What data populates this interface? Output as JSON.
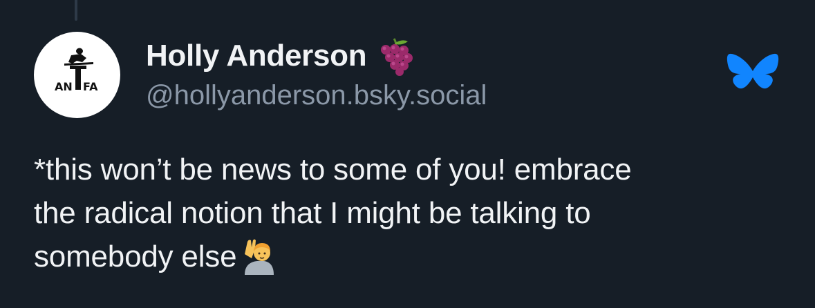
{
  "author": {
    "display_name": "Holly Anderson",
    "name_emoji": "grapes-icon",
    "handle": "@hollyanderson.bsky.social",
    "avatar_text": "AN T FA"
  },
  "post": {
    "lines": [
      "*this won’t be news to some of you! embrace",
      "the radical notion that I might be talking to",
      "somebody else"
    ],
    "trailing_emoji": "person-raising-hand-icon"
  },
  "platform": {
    "logo": "bluesky-butterfly-icon",
    "accent_color": "#1185fe"
  },
  "colors": {
    "background": "#161e27",
    "text": "#f1f3f5",
    "secondary_text": "#8b98a8"
  }
}
